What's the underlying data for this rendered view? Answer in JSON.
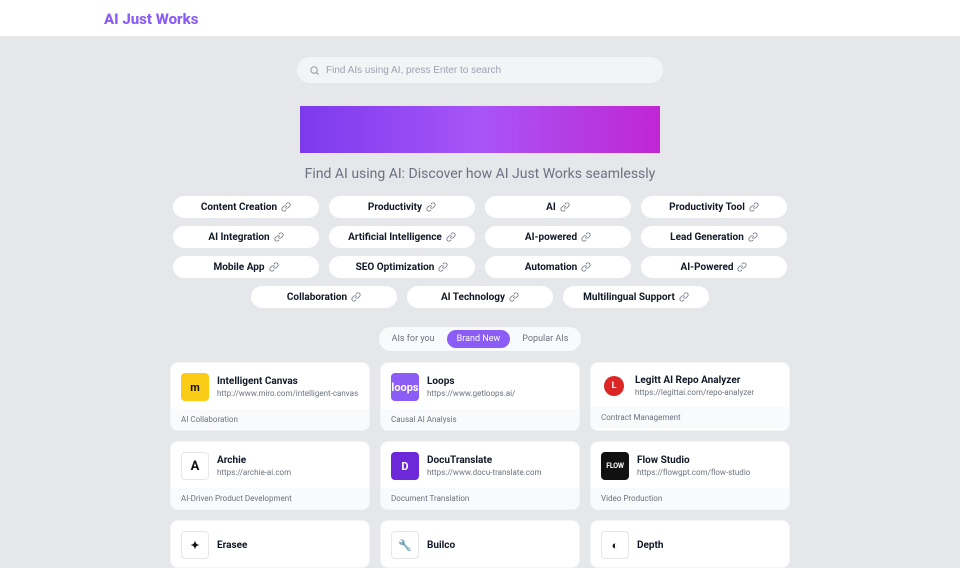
{
  "brand": "AI Just Works",
  "search": {
    "placeholder": "Find AIs using AI, press Enter to search"
  },
  "tagline": "Find AI using AI: Discover how AI Just Works seamlessly",
  "categories": [
    [
      "Content Creation",
      "Productivity",
      "AI",
      "Productivity Tool"
    ],
    [
      "AI Integration",
      "Artificial Intelligence",
      "AI-powered",
      "Lead Generation"
    ],
    [
      "Mobile App",
      "SEO Optimization",
      "Automation",
      "AI-Powered"
    ],
    [
      "Collaboration",
      "AI Technology",
      "Multilingual Support"
    ]
  ],
  "tabs": {
    "items": [
      "AIs for you",
      "Brand New",
      "Popular AIs"
    ],
    "active": 1
  },
  "cards": [
    {
      "title": "Intelligent Canvas",
      "url": "http://www.miro.com/intelligent-canvas",
      "category": "AI Collaboration",
      "icon": {
        "bg": "ic-yellow",
        "text": "m"
      }
    },
    {
      "title": "Loops",
      "url": "https://www.getloops.ai/",
      "category": "Causal AI Analysis",
      "icon": {
        "bg": "ic-purple",
        "text": "loops"
      }
    },
    {
      "title": "Legitt AI Repo Analyzer",
      "url": "https://legittai.com/repo-analyzer",
      "category": "Contract Management",
      "icon": {
        "bg": "ic-redcircle",
        "text": "L"
      }
    },
    {
      "title": "Archie",
      "url": "https://archie-ai.com",
      "category": "AI-Driven Product Development",
      "icon": {
        "bg": "ic-white ic-redlogo",
        "text": "A"
      }
    },
    {
      "title": "DocuTranslate",
      "url": "https://www.docu-translate.com",
      "category": "Document Translation",
      "icon": {
        "bg": "ic-dpurple",
        "text": "D"
      }
    },
    {
      "title": "Flow Studio",
      "url": "https://flowgpt.com/flow-studio",
      "category": "Video Production",
      "icon": {
        "bg": "ic-black",
        "text": "FLOW"
      }
    },
    {
      "title": "Erasee",
      "url": "",
      "category": "",
      "icon": {
        "bg": "ic-white",
        "text": "✦"
      }
    },
    {
      "title": "Builco",
      "url": "",
      "category": "",
      "icon": {
        "bg": "ic-white",
        "text": "🔧"
      }
    },
    {
      "title": "Depth",
      "url": "",
      "category": "",
      "icon": {
        "bg": "ic-white",
        "text": "◐"
      }
    }
  ]
}
